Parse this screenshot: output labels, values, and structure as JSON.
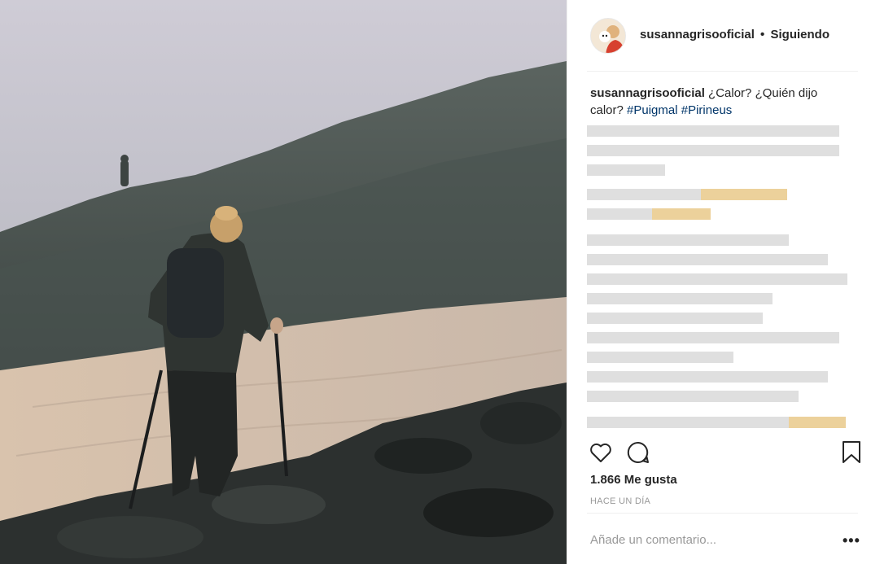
{
  "post": {
    "username": "susannagrisooficial",
    "separator": "•",
    "follow_status": "Siguiendo",
    "caption_text": "¿Calor? ¿Quién dijo calor?",
    "hashtags": [
      "#Puigmal",
      "#Pirineus"
    ],
    "likes": "1.866 Me gusta",
    "time": "HACE UN DÍA",
    "comment_placeholder": "Añade un comentario...",
    "more_label": "•••"
  },
  "icons": {
    "like": "heart-icon",
    "comment": "comment-icon",
    "save": "bookmark-icon",
    "more": "more-options-icon"
  },
  "colors": {
    "hashtag": "#003569",
    "text": "#262626",
    "muted": "#999999",
    "divider": "#efefef"
  }
}
